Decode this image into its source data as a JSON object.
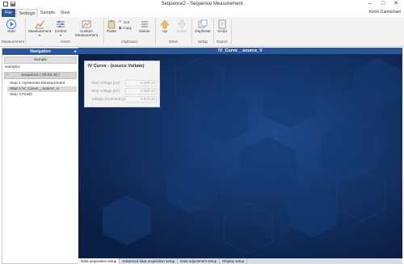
{
  "window": {
    "title": "Sequence2 - Sequence Measurement",
    "user": "Kevin.Carmichael",
    "controls": [
      "minimize-icon",
      "maximize-icon",
      "close-icon"
    ]
  },
  "tabs": [
    {
      "label": "File"
    },
    {
      "label": "Settings"
    },
    {
      "label": "Sample"
    },
    {
      "label": "View"
    }
  ],
  "ribbon": {
    "start": "Start",
    "measurement": "Measurement",
    "control": "Control",
    "custom_measurement": "Custom Measurement",
    "paste": "Paste",
    "cut": "Cut",
    "copy": "Copy",
    "delete": "Delete",
    "up": "Up",
    "down": "Down",
    "duplicate": "Duplicate",
    "script": "Script",
    "groups": {
      "measurement": "Measurement",
      "insert": "Insert",
      "clipboard": "Clipboard",
      "move": "Move",
      "setup": "Setup",
      "export": "Export"
    }
  },
  "navigation": {
    "header": "Navigation",
    "sample_bar": "Sample",
    "sample_name": "Sample1",
    "sequence_bar": "Sequence ( 00:00:48 )",
    "steps": [
      "Step 1 Hysteresis Measurement",
      "Step 2 IV_Curve__source_V",
      "Step 3 Finish"
    ]
  },
  "main": {
    "header": "IV_Curve__source_V",
    "panel": {
      "title": "IV Curve - (source Voltate)",
      "fields": [
        {
          "label": "Start Voltage [uV]",
          "value": "-0.100 uV"
        },
        {
          "label": "Stop Voltage [uV]",
          "value": "0.050 uV"
        },
        {
          "label": "Voltage Increment [uV]",
          "value": "0.010 uV"
        }
      ]
    }
  },
  "bottom_tabs": [
    "Data acquisition setup",
    "Advanced data acquisition setup",
    "Data adjustment setup",
    "Display setup"
  ]
}
